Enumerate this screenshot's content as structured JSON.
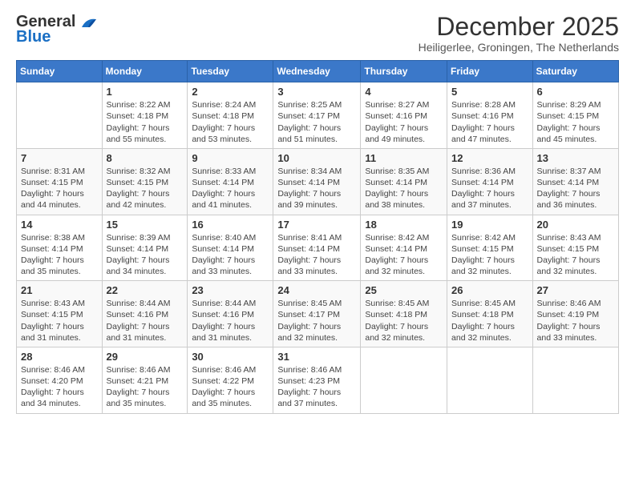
{
  "logo": {
    "general": "General",
    "blue": "Blue"
  },
  "title": "December 2025",
  "subtitle": "Heiligerlee, Groningen, The Netherlands",
  "headers": [
    "Sunday",
    "Monday",
    "Tuesday",
    "Wednesday",
    "Thursday",
    "Friday",
    "Saturday"
  ],
  "weeks": [
    [
      {
        "day": "",
        "info": ""
      },
      {
        "day": "1",
        "info": "Sunrise: 8:22 AM\nSunset: 4:18 PM\nDaylight: 7 hours\nand 55 minutes."
      },
      {
        "day": "2",
        "info": "Sunrise: 8:24 AM\nSunset: 4:18 PM\nDaylight: 7 hours\nand 53 minutes."
      },
      {
        "day": "3",
        "info": "Sunrise: 8:25 AM\nSunset: 4:17 PM\nDaylight: 7 hours\nand 51 minutes."
      },
      {
        "day": "4",
        "info": "Sunrise: 8:27 AM\nSunset: 4:16 PM\nDaylight: 7 hours\nand 49 minutes."
      },
      {
        "day": "5",
        "info": "Sunrise: 8:28 AM\nSunset: 4:16 PM\nDaylight: 7 hours\nand 47 minutes."
      },
      {
        "day": "6",
        "info": "Sunrise: 8:29 AM\nSunset: 4:15 PM\nDaylight: 7 hours\nand 45 minutes."
      }
    ],
    [
      {
        "day": "7",
        "info": "Sunrise: 8:31 AM\nSunset: 4:15 PM\nDaylight: 7 hours\nand 44 minutes."
      },
      {
        "day": "8",
        "info": "Sunrise: 8:32 AM\nSunset: 4:15 PM\nDaylight: 7 hours\nand 42 minutes."
      },
      {
        "day": "9",
        "info": "Sunrise: 8:33 AM\nSunset: 4:14 PM\nDaylight: 7 hours\nand 41 minutes."
      },
      {
        "day": "10",
        "info": "Sunrise: 8:34 AM\nSunset: 4:14 PM\nDaylight: 7 hours\nand 39 minutes."
      },
      {
        "day": "11",
        "info": "Sunrise: 8:35 AM\nSunset: 4:14 PM\nDaylight: 7 hours\nand 38 minutes."
      },
      {
        "day": "12",
        "info": "Sunrise: 8:36 AM\nSunset: 4:14 PM\nDaylight: 7 hours\nand 37 minutes."
      },
      {
        "day": "13",
        "info": "Sunrise: 8:37 AM\nSunset: 4:14 PM\nDaylight: 7 hours\nand 36 minutes."
      }
    ],
    [
      {
        "day": "14",
        "info": "Sunrise: 8:38 AM\nSunset: 4:14 PM\nDaylight: 7 hours\nand 35 minutes."
      },
      {
        "day": "15",
        "info": "Sunrise: 8:39 AM\nSunset: 4:14 PM\nDaylight: 7 hours\nand 34 minutes."
      },
      {
        "day": "16",
        "info": "Sunrise: 8:40 AM\nSunset: 4:14 PM\nDaylight: 7 hours\nand 33 minutes."
      },
      {
        "day": "17",
        "info": "Sunrise: 8:41 AM\nSunset: 4:14 PM\nDaylight: 7 hours\nand 33 minutes."
      },
      {
        "day": "18",
        "info": "Sunrise: 8:42 AM\nSunset: 4:14 PM\nDaylight: 7 hours\nand 32 minutes."
      },
      {
        "day": "19",
        "info": "Sunrise: 8:42 AM\nSunset: 4:15 PM\nDaylight: 7 hours\nand 32 minutes."
      },
      {
        "day": "20",
        "info": "Sunrise: 8:43 AM\nSunset: 4:15 PM\nDaylight: 7 hours\nand 32 minutes."
      }
    ],
    [
      {
        "day": "21",
        "info": "Sunrise: 8:43 AM\nSunset: 4:15 PM\nDaylight: 7 hours\nand 31 minutes."
      },
      {
        "day": "22",
        "info": "Sunrise: 8:44 AM\nSunset: 4:16 PM\nDaylight: 7 hours\nand 31 minutes."
      },
      {
        "day": "23",
        "info": "Sunrise: 8:44 AM\nSunset: 4:16 PM\nDaylight: 7 hours\nand 31 minutes."
      },
      {
        "day": "24",
        "info": "Sunrise: 8:45 AM\nSunset: 4:17 PM\nDaylight: 7 hours\nand 32 minutes."
      },
      {
        "day": "25",
        "info": "Sunrise: 8:45 AM\nSunset: 4:18 PM\nDaylight: 7 hours\nand 32 minutes."
      },
      {
        "day": "26",
        "info": "Sunrise: 8:45 AM\nSunset: 4:18 PM\nDaylight: 7 hours\nand 32 minutes."
      },
      {
        "day": "27",
        "info": "Sunrise: 8:46 AM\nSunset: 4:19 PM\nDaylight: 7 hours\nand 33 minutes."
      }
    ],
    [
      {
        "day": "28",
        "info": "Sunrise: 8:46 AM\nSunset: 4:20 PM\nDaylight: 7 hours\nand 34 minutes."
      },
      {
        "day": "29",
        "info": "Sunrise: 8:46 AM\nSunset: 4:21 PM\nDaylight: 7 hours\nand 35 minutes."
      },
      {
        "day": "30",
        "info": "Sunrise: 8:46 AM\nSunset: 4:22 PM\nDaylight: 7 hours\nand 35 minutes."
      },
      {
        "day": "31",
        "info": "Sunrise: 8:46 AM\nSunset: 4:23 PM\nDaylight: 7 hours\nand 37 minutes."
      },
      {
        "day": "",
        "info": ""
      },
      {
        "day": "",
        "info": ""
      },
      {
        "day": "",
        "info": ""
      }
    ]
  ]
}
